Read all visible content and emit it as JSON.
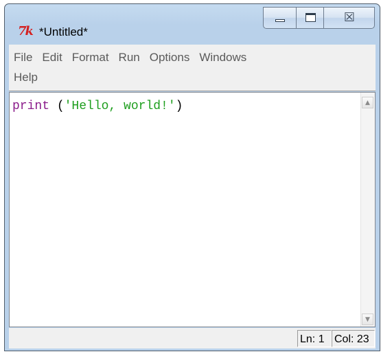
{
  "window": {
    "title": "*Untitled*",
    "app_icon_text": "7k",
    "icon": "idle-python-icon",
    "caption_buttons": {
      "minimize": "minimize-icon",
      "maximize": "maximize-icon",
      "close": "close-icon",
      "close_glyph": "☒"
    }
  },
  "menubar": {
    "items": [
      {
        "label": "File"
      },
      {
        "label": "Edit"
      },
      {
        "label": "Format"
      },
      {
        "label": "Run"
      },
      {
        "label": "Options"
      },
      {
        "label": "Windows"
      },
      {
        "label": "Help"
      }
    ]
  },
  "editor": {
    "code": {
      "keyword": "print",
      "open": " (",
      "string": "'Hello, world!'",
      "close": ")"
    },
    "colors": {
      "keyword": "#8b1c8b",
      "string": "#1e9e1e"
    },
    "scrollbar": {
      "up_glyph": "▲",
      "down_glyph": "▼"
    }
  },
  "status": {
    "line": "Ln: 1",
    "column": "Col: 23"
  }
}
